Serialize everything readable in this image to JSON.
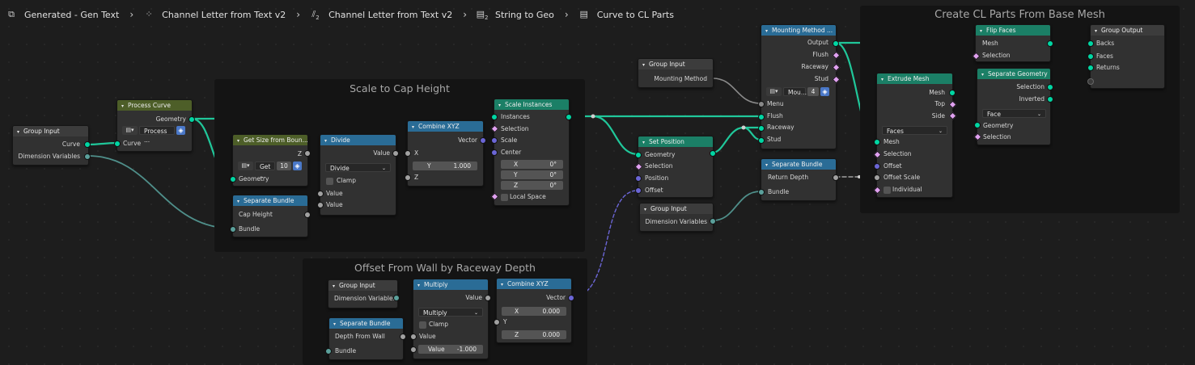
{
  "breadcrumbs": [
    {
      "label": "Generated - Gen Text",
      "icon": "node-tree-icon"
    },
    {
      "label": "Channel Letter from Text v2",
      "icon": "node-group-icon"
    },
    {
      "label": "Channel Letter from Text v2",
      "icon": "node-group-icon",
      "sub": "2"
    },
    {
      "label": "String to Geo",
      "icon": "node-group-icon",
      "sub": "2"
    },
    {
      "label": "Curve to CL Parts",
      "icon": "node-group-icon"
    }
  ],
  "frames": {
    "scale": "Scale to Cap Height",
    "offset": "Offset From Wall by Raceway Depth",
    "create": "Create CL Parts From Base Mesh"
  },
  "colors": {
    "geometry": "#00d6a3",
    "vector": "#6b66d6",
    "float": "#a1a1a1",
    "bundle": "#5ba09b",
    "frame": "#141414",
    "geometry_header": "#1b7f66",
    "utility_header": "#2a6c96",
    "group_header": "#3c3c3c",
    "function_header": "#4d5e28"
  },
  "nodes": {
    "group_input_1": {
      "title": "Group Input",
      "out1": "Curve",
      "out2": "Dimension Variables"
    },
    "process_curve": {
      "title": "Process Curve",
      "out": "Geometry",
      "select": "Process ...",
      "in": "Curve"
    },
    "get_size": {
      "title": "Get Size from Boun...",
      "out": "Z",
      "select": "Get ...",
      "num": "10",
      "in": "Geometry"
    },
    "sep_bundle_1": {
      "title": "Separate Bundle",
      "out": "Cap Height",
      "in": "Bundle"
    },
    "divide": {
      "title": "Divide",
      "out": "Value",
      "op": "Divide",
      "clamp": "Clamp",
      "in1": "Value",
      "in2": "Value"
    },
    "combine_1": {
      "title": "Combine XYZ",
      "out": "Vector",
      "x": "X",
      "y_label": "Y",
      "y_val": "1.000",
      "z": "Z"
    },
    "scale_instances": {
      "title": "Scale Instances",
      "out": "Instances",
      "in1": "Instances",
      "in2": "Selection",
      "in3": "Scale",
      "in4": "Center",
      "cx": "X",
      "cx_v": "0°",
      "cy": "Y",
      "cy_v": "0°",
      "cz": "Z",
      "cz_v": "0°",
      "local": "Local Space"
    },
    "group_input_2": {
      "title": "Group Input",
      "out": "Mounting Method"
    },
    "set_position": {
      "title": "Set Position",
      "out": "Geometry",
      "in1": "Geometry",
      "in2": "Selection",
      "in3": "Position",
      "in4": "Offset"
    },
    "group_input_3": {
      "title": "Group Input",
      "out": "Dimension Variables"
    },
    "mounting": {
      "title": "Mounting Method ...",
      "o1": "Output",
      "o2": "Flush",
      "o3": "Raceway",
      "o4": "Stud",
      "select": "Mou...",
      "num": "4",
      "i1": "Menu",
      "i2": "Flush",
      "i3": "Raceway",
      "i4": "Stud"
    },
    "sep_bundle_2": {
      "title": "Separate Bundle",
      "out": "Return Depth",
      "in": "Bundle"
    },
    "extrude": {
      "title": "Extrude Mesh",
      "o1": "Mesh",
      "o2": "Top",
      "o3": "Side",
      "mode": "Faces",
      "i1": "Mesh",
      "i2": "Selection",
      "i3": "Offset",
      "i4": "Offset Scale",
      "i5": "Individual"
    },
    "flip": {
      "title": "Flip Faces",
      "out": "Mesh",
      "in": "Selection"
    },
    "sep_geo": {
      "title": "Separate Geometry",
      "o1": "Selection",
      "o2": "Inverted",
      "domain": "Face",
      "i1": "Geometry",
      "i2": "Selection"
    },
    "group_output": {
      "title": "Group Output",
      "i1": "Backs",
      "i2": "Faces",
      "i3": "Returns"
    },
    "group_input_4": {
      "title": "Group Input",
      "out": "Dimension Variables"
    },
    "sep_bundle_3": {
      "title": "Separate Bundle",
      "out": "Depth From Wall",
      "in": "Bundle"
    },
    "multiply": {
      "title": "Multiply",
      "out": "Value",
      "op": "Multiply",
      "clamp": "Clamp",
      "in": "Value",
      "fld_label": "Value",
      "fld_val": "-1.000"
    },
    "combine_2": {
      "title": "Combine XYZ",
      "out": "Vector",
      "x": "X",
      "x_v": "0.000",
      "y": "Y",
      "z": "Z",
      "z_v": "0.000"
    }
  }
}
